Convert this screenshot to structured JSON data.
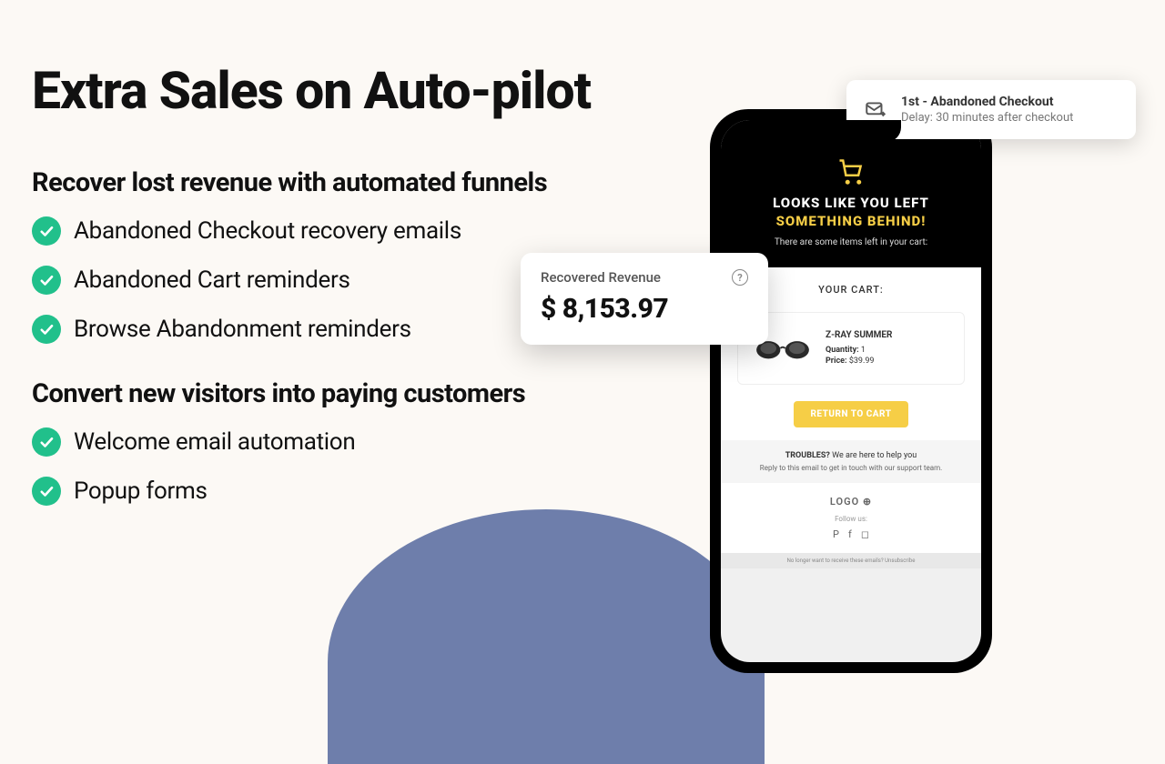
{
  "title": "Extra Sales on Auto-pilot",
  "sections": [
    {
      "heading": "Recover lost revenue with automated funnels",
      "items": [
        "Abandoned Checkout recovery emails",
        "Abandoned Cart reminders",
        "Browse Abandonment reminders"
      ]
    },
    {
      "heading": "Convert new visitors into paying customers",
      "items": [
        "Welcome email automation",
        "Popup forms"
      ]
    }
  ],
  "notification": {
    "title": "1st - Abandoned Checkout",
    "subtitle": "Delay: 30 minutes after checkout"
  },
  "revenue": {
    "label": "Recovered Revenue",
    "amount": "$ 8,153.97"
  },
  "email": {
    "title_line1": "LOOKS LIKE YOU LEFT",
    "title_line2": "SOMETHING BEHIND!",
    "subtitle": "There are some items left in your cart:",
    "cart_label": "YOUR CART:",
    "product": {
      "name": "Z-RAY SUMMER",
      "qty_label": "Quantity:",
      "qty": "1",
      "price_label": "Price:",
      "price": "$39.99"
    },
    "cta": "RETURN TO CART",
    "troubles_bold": "TROUBLES?",
    "troubles_rest": " We are here to help you",
    "reply_note": "Reply to this email to get in touch with our support team.",
    "logo": "LOGO",
    "follow": "Follow us:",
    "unsubscribe": "No longer want to receive these emails? Unsubscribe"
  }
}
